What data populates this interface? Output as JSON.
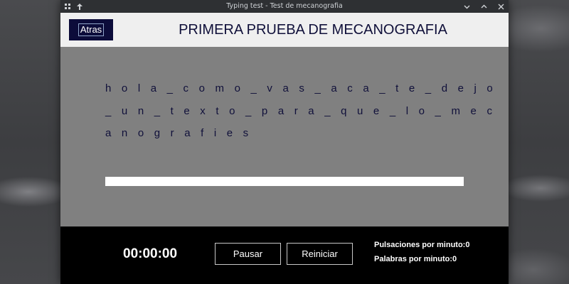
{
  "window": {
    "title": "Typing test - Test de mecanografia"
  },
  "header": {
    "back_label": "Atras",
    "title": "PRIMERA PRUEBA DE MECANOGRAFIA"
  },
  "typing": {
    "lines": [
      "h o l a _ c o m o _ v a s _ a c a _ t e _ d e j o",
      "_ u n _ t e x t o _ p a r a _ q u e _ l o _ m e c",
      "a n o g r a f i e s"
    ],
    "input_value": ""
  },
  "footer": {
    "timer": "00:00:00",
    "pause_label": "Pausar",
    "restart_label": "Reiniciar",
    "keystrokes_per_minute": "Pulsaciones por minuto:0",
    "words_per_minute": "Palabras por minuto:0"
  },
  "icons": {
    "titlebar_left": [
      "grid-icon",
      "pin-icon"
    ],
    "titlebar_right": [
      "minimize-icon",
      "maximize-icon",
      "close-icon"
    ]
  },
  "colors": {
    "header_bg": "#efefef",
    "title_text": "#10103a",
    "back_button_bg": "#0c0c3a",
    "content_bg": "#808080",
    "footer_bg": "#000000"
  }
}
